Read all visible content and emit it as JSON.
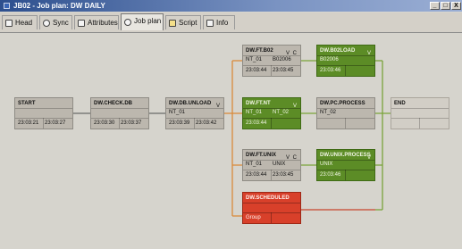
{
  "window": {
    "title": "JB02 - Job plan: DW DAILY",
    "controls": [
      "_",
      "□",
      "X"
    ]
  },
  "tabs": [
    {
      "label": "Head",
      "icon": "document-icon"
    },
    {
      "label": "Sync",
      "icon": "sync-icon"
    },
    {
      "label": "Attributes",
      "icon": "attributes-icon"
    },
    {
      "label": "Job plan",
      "icon": "job-plan-icon",
      "active": true
    },
    {
      "label": "Script",
      "icon": "script-icon"
    },
    {
      "label": "Info",
      "icon": "info-icon"
    }
  ],
  "colors": {
    "link_gray": "#6a6a6a",
    "link_orange": "#d98a3a",
    "link_green": "#7aa33a",
    "link_red": "#c8452d",
    "node_gray": "#bcb7ae",
    "node_green": "#5c8c26",
    "node_red": "#d8402a"
  },
  "jobplan": {
    "start": {
      "name": "START",
      "v": "",
      "c": "",
      "r1a": "",
      "r1b": "",
      "r2a": "23:03:21",
      "r2b": "23:03:27"
    },
    "check_db": {
      "name": "DW.CHECK.DB",
      "v": "",
      "c": "",
      "r1a": "",
      "r1b": "",
      "r2a": "23:03:30",
      "r2b": "23:03:37"
    },
    "db_unload": {
      "name": "DW.DB.UNLOAD",
      "v": "V",
      "c": "",
      "r1a": "NT_01",
      "r1b": "",
      "r2a": "23:03:39",
      "r2b": "23:03:42"
    },
    "ft_b02": {
      "name": "DW.FT.B02",
      "v": "V",
      "c": "C",
      "r1a": "NT_01",
      "r1b": "B02006",
      "r2a": "23:03:44",
      "r2b": "23:03:45"
    },
    "b02load": {
      "name": "DW.B02LOAD",
      "v": "V",
      "c": "",
      "r1a": "B02006",
      "r1b": "",
      "r2a": "23:03:46",
      "r2b": ""
    },
    "ft_nt": {
      "name": "DW.FT.NT",
      "v": "V",
      "c": "",
      "r1a": "NT_01",
      "r1b": "NT_02",
      "r2a": "23:03:44",
      "r2b": ""
    },
    "pc_process": {
      "name": "DW.PC.PROCESS",
      "v": "",
      "c": "",
      "r1a": "NT_02",
      "r1b": "",
      "r2a": "",
      "r2b": ""
    },
    "end": {
      "name": "END",
      "v": "",
      "c": "",
      "r1a": "",
      "r1b": "",
      "r2a": "",
      "r2b": ""
    },
    "ft_unix": {
      "name": "DW.FT.UNIX",
      "v": "V",
      "c": "C",
      "r1a": "NT_01",
      "r1b": "UNIX",
      "r2a": "23:03:44",
      "r2b": "23:03:45"
    },
    "unix_process": {
      "name": "DW.UNIX.PROCESS",
      "v": "V",
      "c": "",
      "r1a": "UNIX",
      "r1b": "",
      "r2a": "23:03:46",
      "r2b": ""
    },
    "scheduled": {
      "name": "DW.SCHEDULED",
      "v": "",
      "c": "",
      "r1a": "",
      "r1b": "",
      "r2a": "Group",
      "r2b": ""
    }
  }
}
